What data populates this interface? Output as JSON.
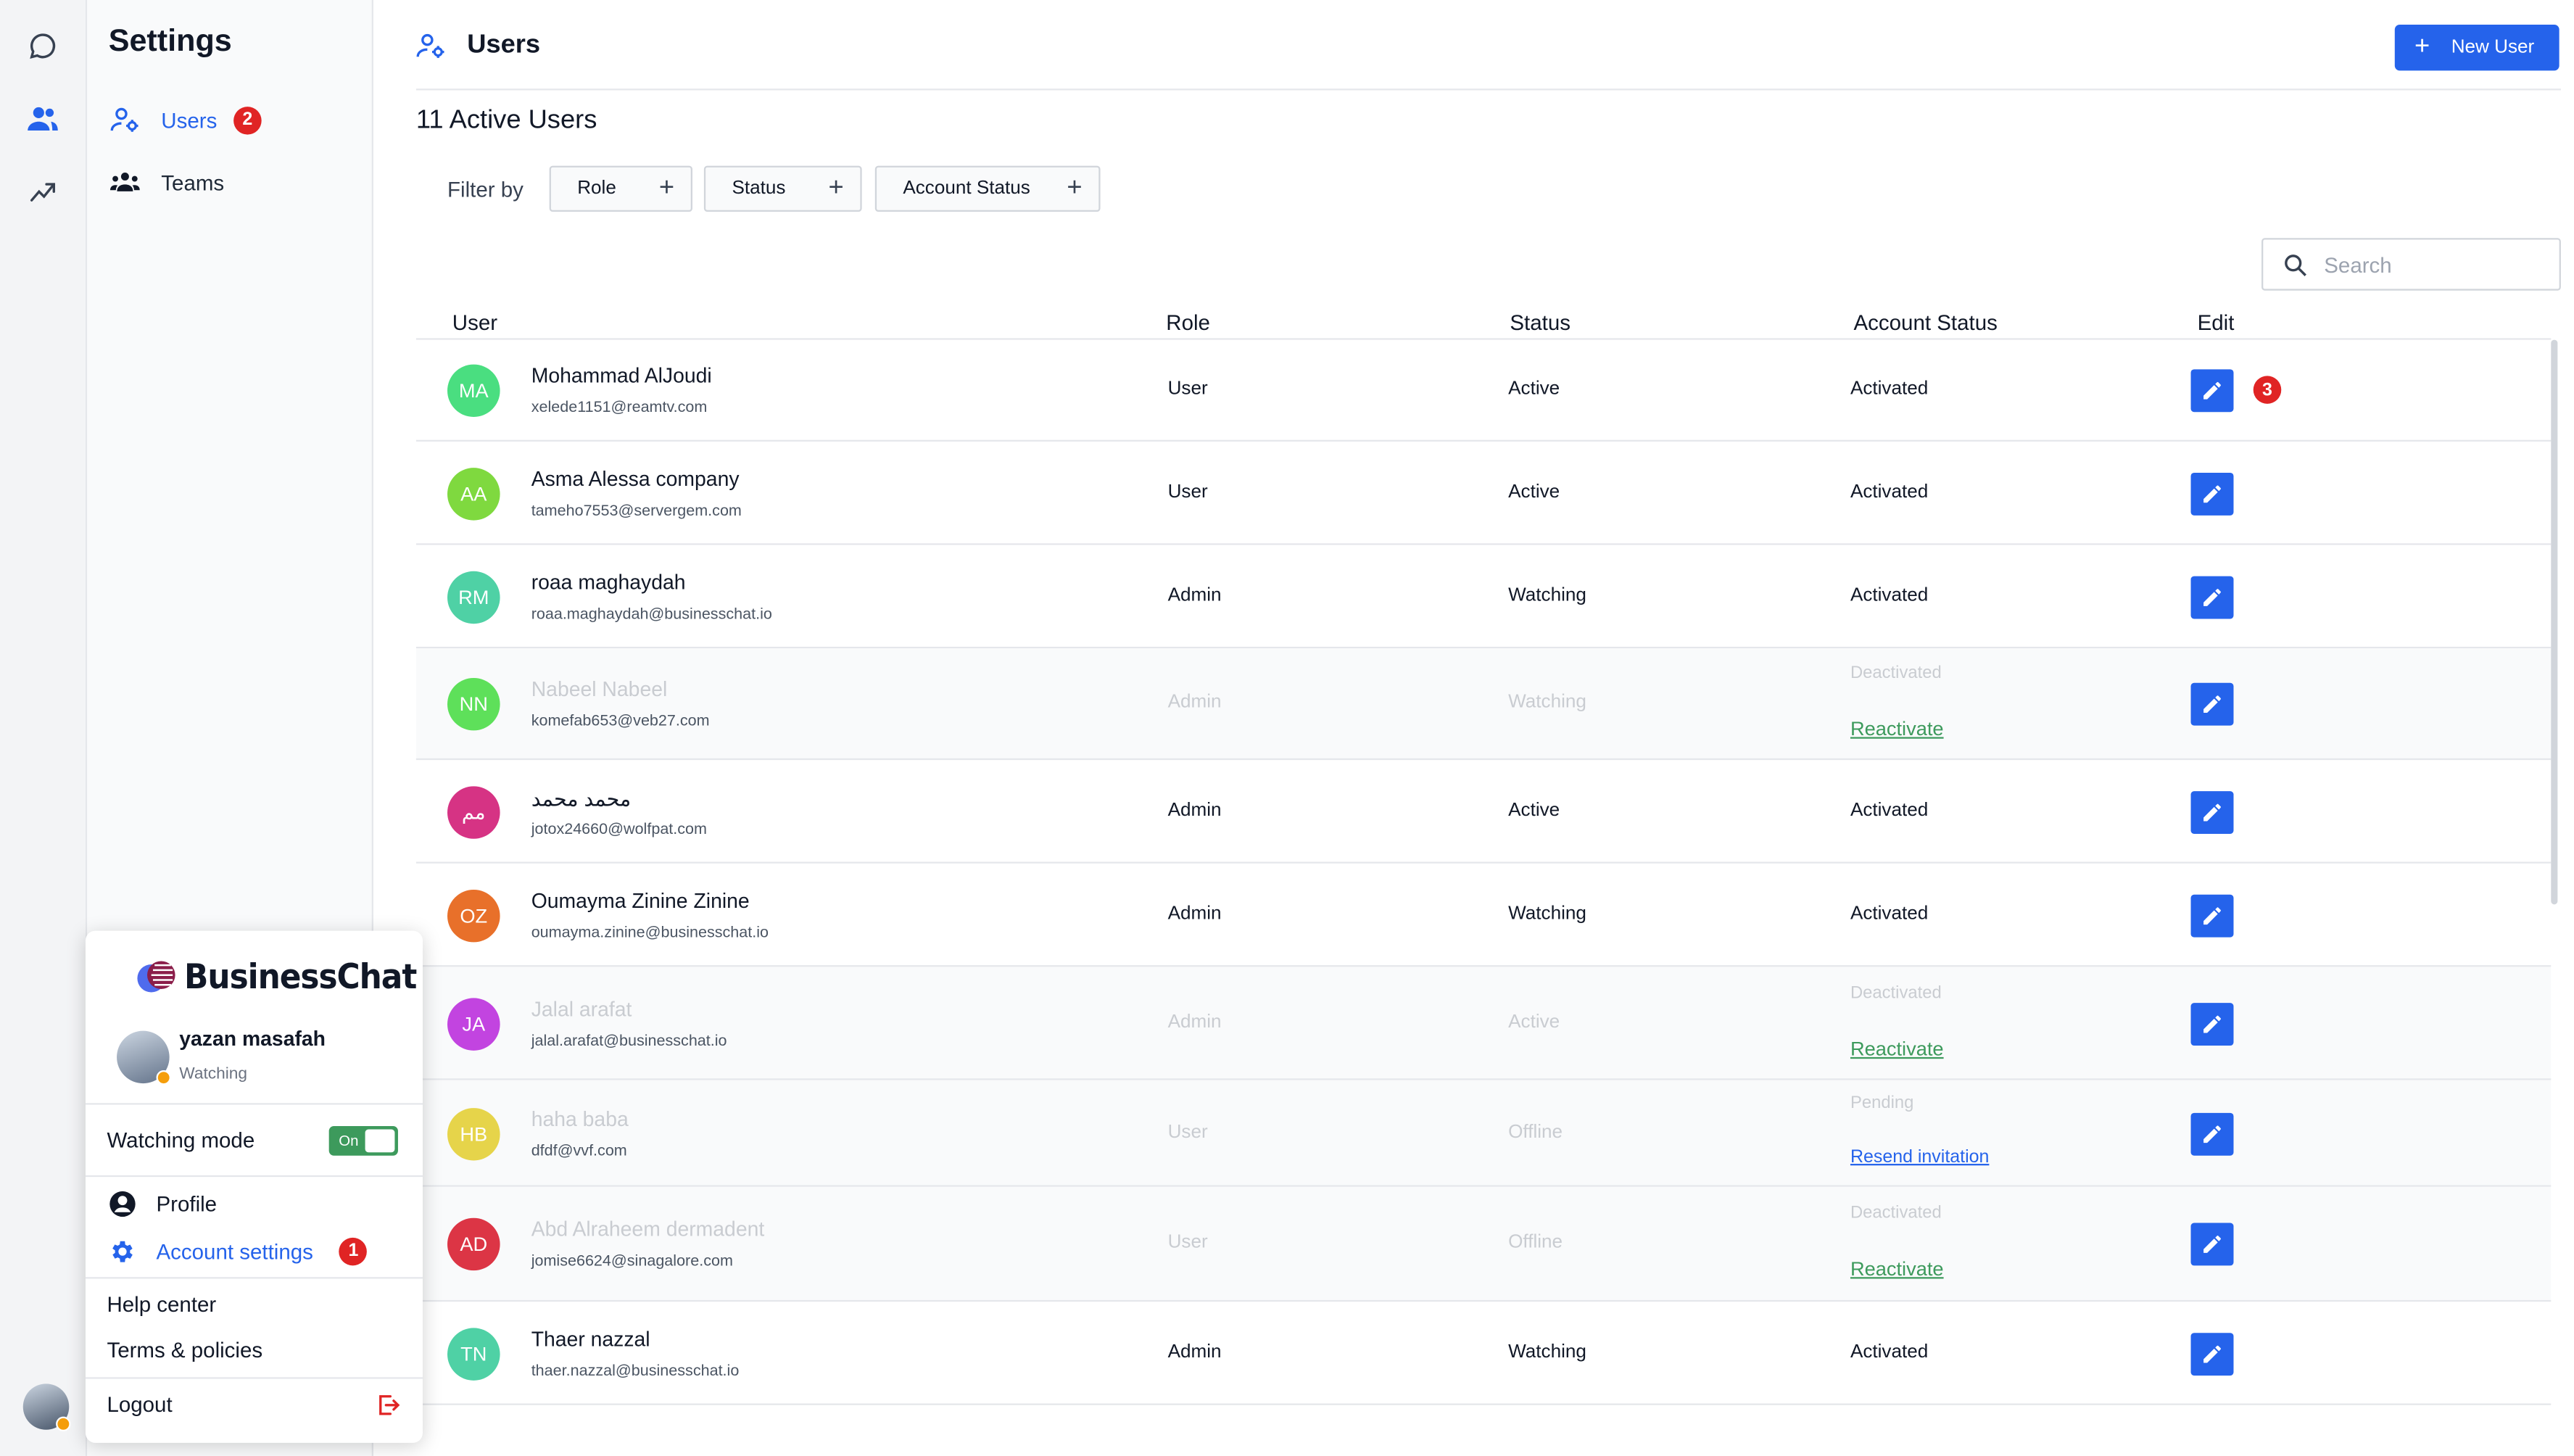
{
  "sidebar": {
    "title": "Settings",
    "items": [
      {
        "label": "Users",
        "badge": "2",
        "icon": "users-settings-icon"
      },
      {
        "label": "Teams",
        "icon": "team-icon"
      }
    ]
  },
  "rail": {
    "icons": [
      "chat-icon",
      "users-icon",
      "analytics-icon"
    ]
  },
  "header": {
    "title": "Users",
    "new_user_label": "New User"
  },
  "summary": {
    "title": "11 Active Users"
  },
  "filters": {
    "label": "Filter by",
    "buttons": [
      {
        "label": "Role"
      },
      {
        "label": "Status"
      },
      {
        "label": "Account Status"
      }
    ]
  },
  "search": {
    "placeholder": "Search"
  },
  "table": {
    "columns": [
      "User",
      "Role",
      "Status",
      "Account Status",
      "Edit"
    ],
    "rows": [
      {
        "initials": "MA",
        "avatar_color": "#4ade80",
        "name": "Mohammad AlJoudi",
        "email": "xelede1151@reamtv.com",
        "role": "User",
        "status": "Active",
        "account_status": "Activated",
        "badge": "3"
      },
      {
        "initials": "AA",
        "avatar_color": "#7fd93f",
        "name": "Asma Alessa company",
        "email": "tameho7553@servergem.com",
        "role": "User",
        "status": "Active",
        "account_status": "Activated"
      },
      {
        "initials": "RM",
        "avatar_color": "#4fd1a5",
        "name": "roaa maghaydah",
        "email": "roaa.maghaydah@businesschat.io",
        "role": "Admin",
        "status": "Watching",
        "account_status": "Activated"
      },
      {
        "initials": "NN",
        "avatar_color": "#5ee05a",
        "name": "Nabeel Nabeel",
        "email": "komefab653@veb27.com",
        "role": "Admin",
        "status": "Watching",
        "account_status": "Deactivated",
        "action": "Reactivate"
      },
      {
        "initials": "مم",
        "avatar_color": "#d63384",
        "name": "محمد محمد",
        "email": "jotox24660@wolfpat.com",
        "role": "Admin",
        "status": "Active",
        "account_status": "Activated"
      },
      {
        "initials": "OZ",
        "avatar_color": "#e8702a",
        "name": "Oumayma Zinine Zinine",
        "email": "oumayma.zinine@businesschat.io",
        "role": "Admin",
        "status": "Watching",
        "account_status": "Activated"
      },
      {
        "initials": "JA",
        "avatar_color": "#c244e0",
        "name": "Jalal arafat",
        "email": "jalal.arafat@businesschat.io",
        "role": "Admin",
        "status": "Active",
        "account_status": "Deactivated",
        "action": "Reactivate"
      },
      {
        "initials": "HB",
        "avatar_color": "#e6d44a",
        "name": "haha baba",
        "email": "dfdf@vvf.com",
        "role": "User",
        "status": "Offline",
        "account_status": "Pending",
        "action": "Resend invitation"
      },
      {
        "initials": "AD",
        "avatar_color": "#dc3545",
        "name": "Abd Alraheem dermadent",
        "email": "jomise6624@sinagalore.com",
        "role": "User",
        "status": "Offline",
        "account_status": "Deactivated",
        "action": "Reactivate"
      },
      {
        "initials": "TN",
        "avatar_color": "#4fd1a5",
        "name": "Thaer nazzal",
        "email": "thaer.nazzal@businesschat.io",
        "role": "Admin",
        "status": "Watching",
        "account_status": "Activated"
      }
    ]
  },
  "popover": {
    "brand": "BusinessChat",
    "user_name": "yazan masafah",
    "user_status": "Watching",
    "watching_mode_label": "Watching mode",
    "toggle_label": "On",
    "profile_label": "Profile",
    "account_settings_label": "Account settings",
    "account_settings_badge": "1",
    "help_label": "Help center",
    "terms_label": "Terms & policies",
    "logout_label": "Logout"
  },
  "colors": {
    "accent": "#2563eb",
    "badge": "#e02424",
    "success": "#3d9a5c"
  }
}
